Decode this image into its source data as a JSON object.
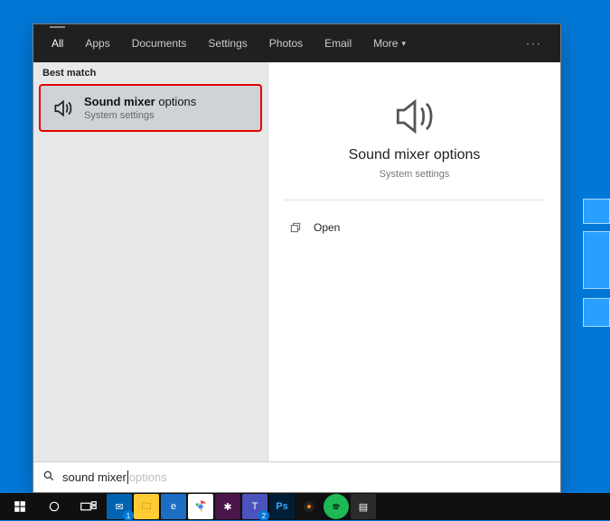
{
  "tabs": {
    "items": [
      "All",
      "Apps",
      "Documents",
      "Settings",
      "Photos",
      "Email",
      "More"
    ],
    "activeIndex": 0
  },
  "left": {
    "sectionLabel": "Best match",
    "result": {
      "titleBold": "Sound mixer",
      "titleRest": " options",
      "subtitle": "System settings"
    }
  },
  "right": {
    "title": "Sound mixer options",
    "subtitle": "System settings",
    "actions": {
      "open": "Open"
    }
  },
  "search": {
    "typed": "sound mixer",
    "suggestion": " options"
  },
  "taskbar": {
    "mailBadge": "1",
    "teamsBadge": "2"
  }
}
